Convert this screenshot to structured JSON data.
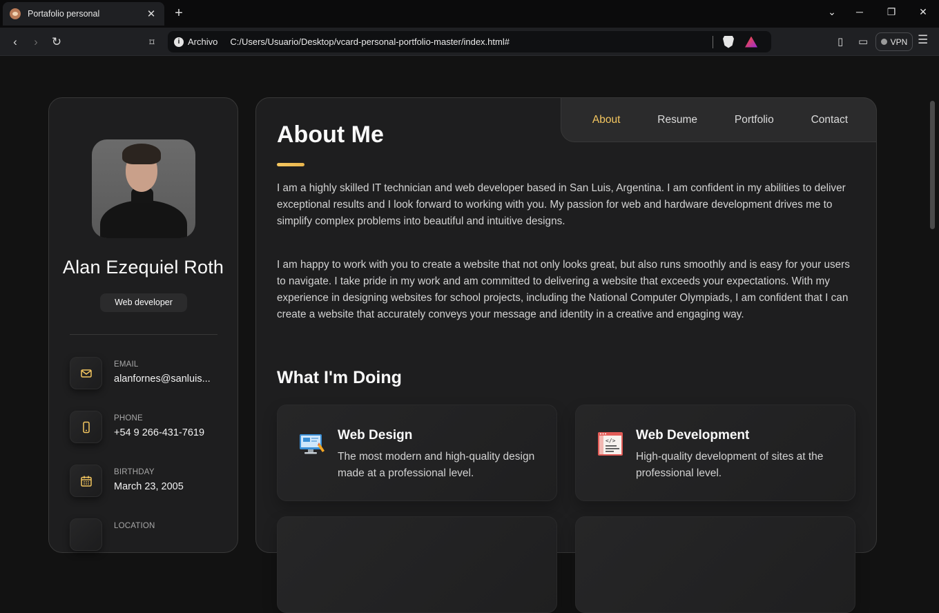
{
  "browser": {
    "tab_title": "Portafolio personal",
    "address_label": "Archivo",
    "url": "C:/Users/Usuario/Desktop/vcard-personal-portfolio-master/index.html#",
    "vpn_label": "VPN"
  },
  "sidebar": {
    "name": "Alan Ezequiel Roth",
    "title": "Web developer",
    "contacts": [
      {
        "label": "EMAIL",
        "value": "alanfornes@sanluis...",
        "icon": "mail-icon"
      },
      {
        "label": "PHONE",
        "value": "+54 9 266-431-7619",
        "icon": "phone-icon"
      },
      {
        "label": "BIRTHDAY",
        "value": "March 23, 2005",
        "icon": "calendar-icon"
      },
      {
        "label": "LOCATION",
        "value": "",
        "icon": "location-icon"
      }
    ]
  },
  "navbar": {
    "items": [
      "About",
      "Resume",
      "Portfolio",
      "Contact"
    ],
    "active": "About"
  },
  "about": {
    "title": "About Me",
    "paragraphs": [
      "I am a highly skilled IT technician and web developer based in San Luis, Argentina. I am confident in my abilities to deliver exceptional results and I look forward to working with you. My passion for web and hardware development drives me to simplify complex problems into beautiful and intuitive designs.",
      "I am happy to work with you to create a website that not only looks great, but also runs smoothly and is easy for your users to navigate. I take pride in my work and am committed to delivering a website that exceeds your expectations. With my experience in designing websites for school projects, including the National Computer Olympiads, I am confident that I can create a website that accurately conveys your message and identity in a creative and engaging way."
    ],
    "services_title": "What I'm Doing",
    "services": [
      {
        "title": "Web Design",
        "text": "The most modern and high-quality design made at a professional level.",
        "icon": "web-design-icon"
      },
      {
        "title": "Web Development",
        "text": "High-quality development of sites at the professional level.",
        "icon": "web-development-icon"
      }
    ]
  },
  "colors": {
    "accent": "#f5c760",
    "page_bg": "#121212",
    "card_bg": "#1e1e1f",
    "border": "#383838"
  }
}
